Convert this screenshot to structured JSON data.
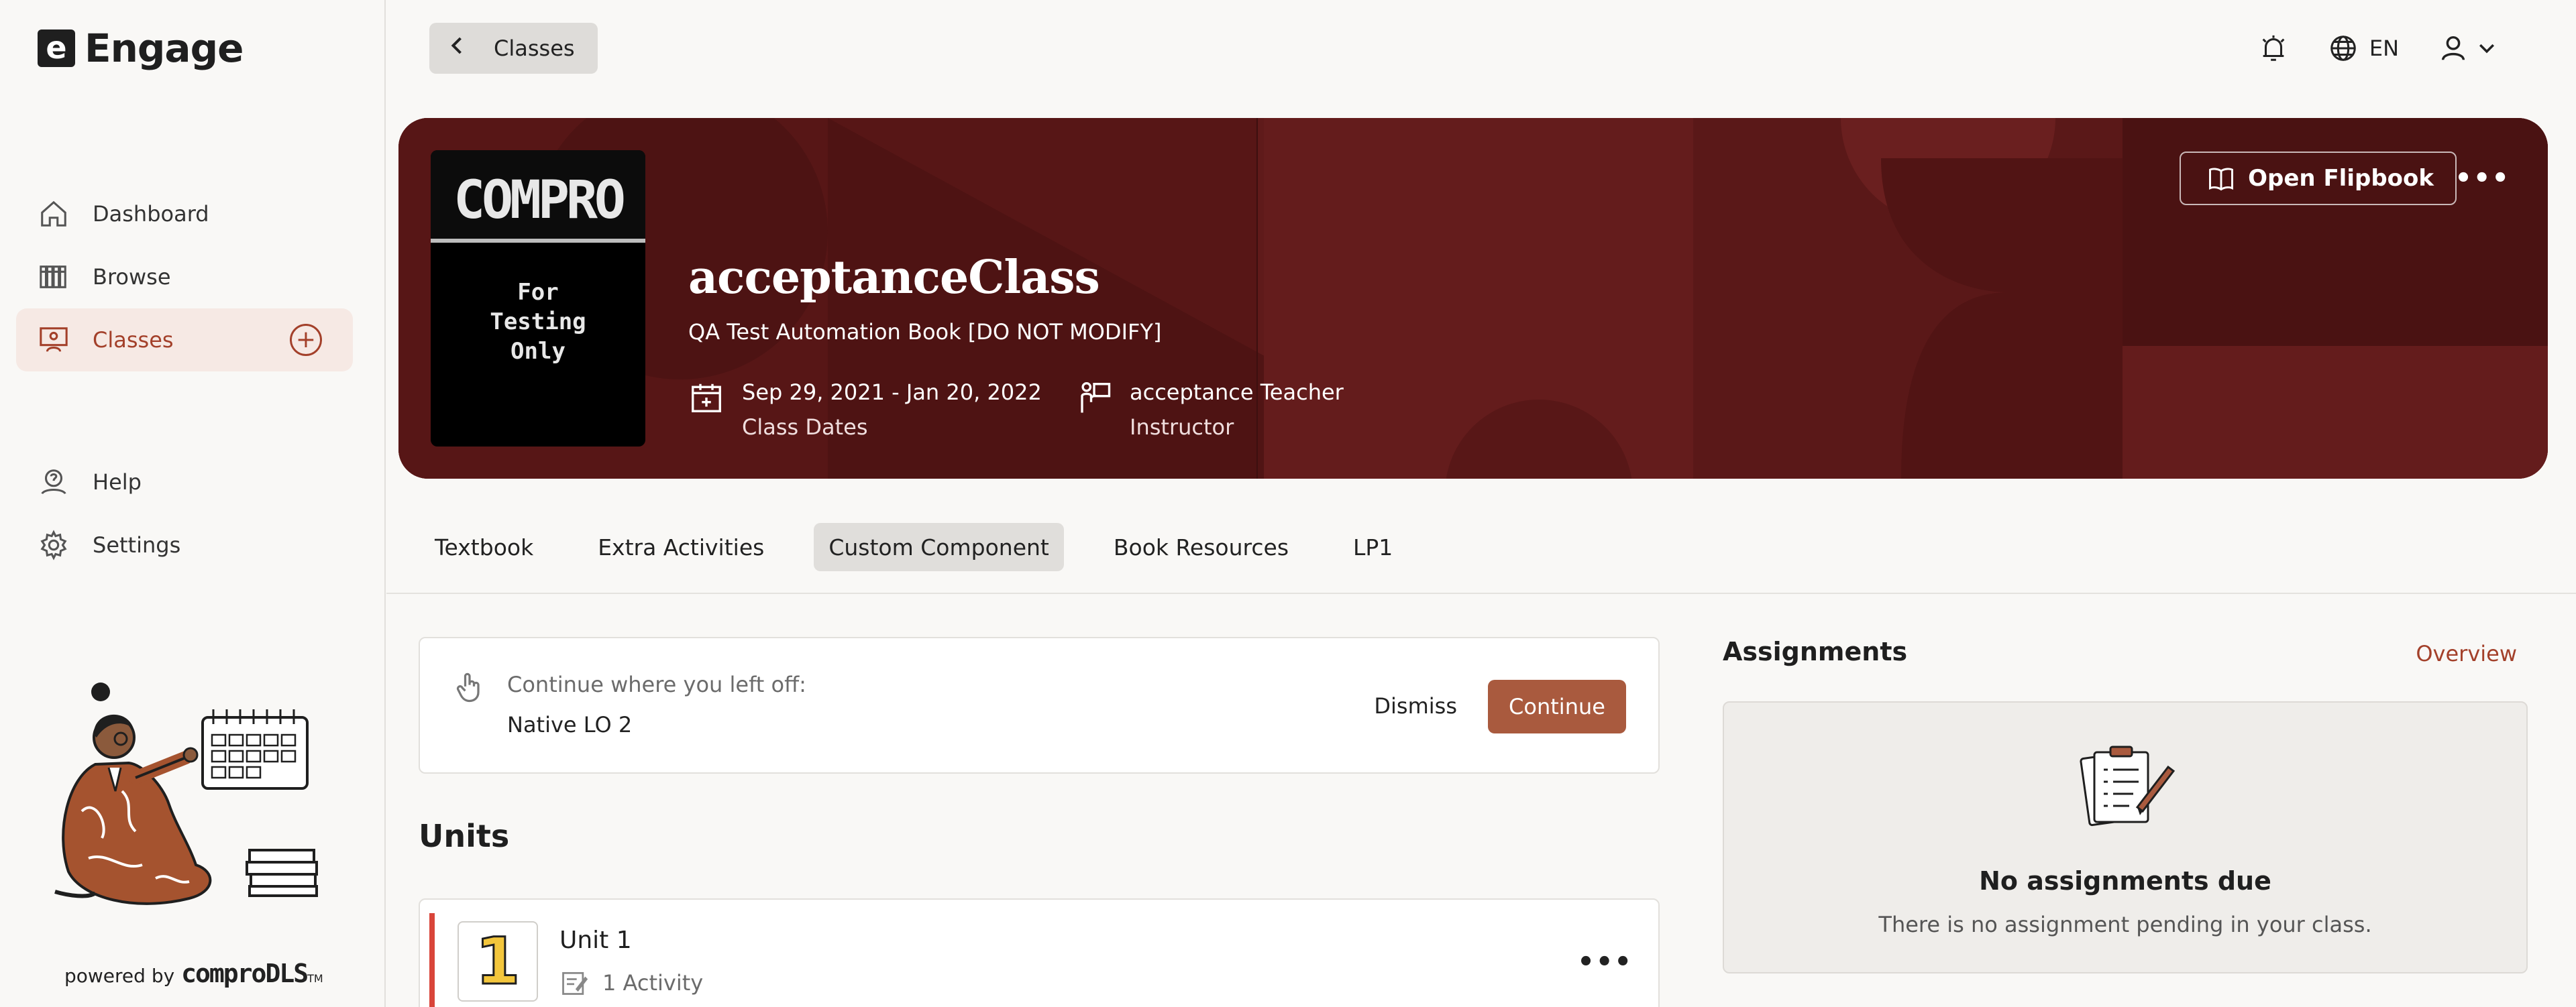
{
  "app": {
    "logo_letter": "e",
    "name": "Engage"
  },
  "sidebar": {
    "items": [
      {
        "label": "Dashboard",
        "icon": "home-icon"
      },
      {
        "label": "Browse",
        "icon": "books-icon"
      },
      {
        "label": "Classes",
        "icon": "classroom-icon",
        "active": true
      },
      {
        "label": "Help",
        "icon": "help-icon"
      },
      {
        "label": "Settings",
        "icon": "gear-icon"
      }
    ],
    "powered_by": "powered by",
    "powered_brand": "comproDLS",
    "powered_tm": "TM"
  },
  "topbar": {
    "back_label": "Classes",
    "language": "EN"
  },
  "banner": {
    "book_title": "COMPRO",
    "book_subtitle": "For\nTesting\nOnly",
    "class_title": "acceptanceClass",
    "class_subtitle": "QA Test Automation Book [DO NOT MODIFY]",
    "dates": "Sep 29, 2021 - Jan 20, 2022",
    "dates_label": "Class Dates",
    "instructor": "acceptance Teacher",
    "instructor_label": "Instructor",
    "flipbook_label": "Open Flipbook",
    "more_label": "•••",
    "color": "#5f1a1a"
  },
  "tabs": [
    {
      "label": "Textbook"
    },
    {
      "label": "Extra Activities"
    },
    {
      "label": "Custom Component",
      "active": true
    },
    {
      "label": "Book Resources"
    },
    {
      "label": "LP1"
    }
  ],
  "continue_card": {
    "label": "Continue where you left off:",
    "value": "Native LO 2",
    "dismiss_label": "Dismiss",
    "continue_label": "Continue"
  },
  "units": {
    "heading": "Units",
    "items": [
      {
        "number": "1",
        "title": "Unit 1",
        "activities": "1 Activity"
      }
    ]
  },
  "assignments": {
    "heading": "Assignments",
    "overview_label": "Overview",
    "empty_title": "No assignments due",
    "empty_desc": "There is no assignment pending in your class."
  },
  "colors": {
    "accent": "#a3402a",
    "continue_button": "#a95a3e",
    "unit_accent": "#d9453a"
  }
}
